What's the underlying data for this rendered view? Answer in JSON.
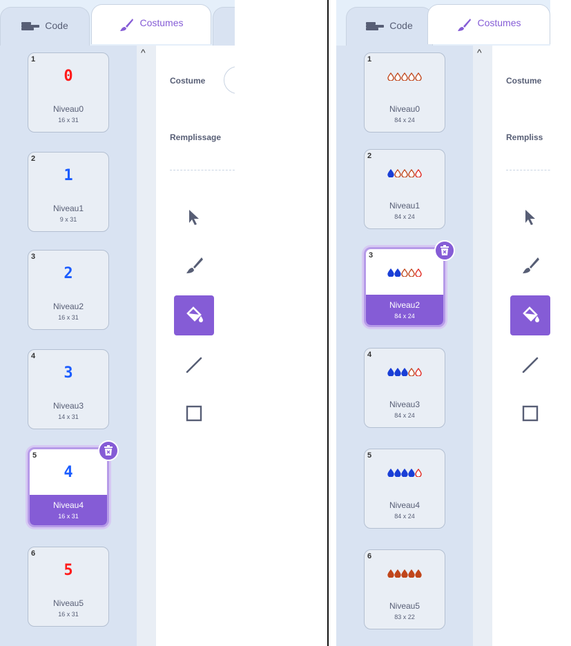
{
  "left": {
    "tabs": {
      "code": "Code",
      "costumes": "Costumes"
    },
    "fields": {
      "costume_label": "Costume",
      "fill_label": "Remplissage"
    },
    "costumes": [
      {
        "number": "1",
        "glyph": "0",
        "glyph_color": "#ff1a1a",
        "name": "Niveau0",
        "size": "16 x 31"
      },
      {
        "number": "2",
        "glyph": "1",
        "glyph_color": "#1a5cff",
        "name": "Niveau1",
        "size": "9 x 31"
      },
      {
        "number": "3",
        "glyph": "2",
        "glyph_color": "#1a5cff",
        "name": "Niveau2",
        "size": "16 x 31"
      },
      {
        "number": "4",
        "glyph": "3",
        "glyph_color": "#1a5cff",
        "name": "Niveau3",
        "size": "14 x 31"
      },
      {
        "number": "5",
        "glyph": "4",
        "glyph_color": "#1a5cff",
        "name": "Niveau4",
        "size": "16 x 31",
        "selected": true
      },
      {
        "number": "6",
        "glyph": "5",
        "glyph_color": "#ff1a1a",
        "name": "Niveau5",
        "size": "16 x 31"
      }
    ]
  },
  "right": {
    "tabs": {
      "code": "Code",
      "costumes": "Costumes"
    },
    "fields": {
      "costume_label": "Costume",
      "fill_label": "Rempliss"
    },
    "costumes": [
      {
        "number": "1",
        "name": "Niveau0",
        "size": "84 x 24",
        "drops": [
          "outline-brown",
          "outline-brown",
          "outline-brown",
          "outline-brown",
          "outline-brown"
        ]
      },
      {
        "number": "2",
        "name": "Niveau1",
        "size": "84 x 24",
        "drops": [
          "blue",
          "outline-brown",
          "outline-brown",
          "outline-brown",
          "outline-red"
        ]
      },
      {
        "number": "3",
        "name": "Niveau2",
        "size": "84 x 24",
        "selected": true,
        "drops": [
          "blue",
          "blue",
          "outline-brown",
          "outline-brown",
          "outline-red"
        ]
      },
      {
        "number": "4",
        "name": "Niveau3",
        "size": "84 x 24",
        "drops": [
          "blue",
          "blue",
          "blue",
          "outline-brown",
          "outline-red"
        ]
      },
      {
        "number": "5",
        "name": "Niveau4",
        "size": "84 x 24",
        "drops": [
          "blue",
          "blue",
          "blue",
          "blue",
          "outline-red"
        ]
      },
      {
        "number": "6",
        "name": "Niveau5",
        "size": "83 x 22",
        "drops": [
          "brown",
          "brown",
          "brown",
          "brown",
          "brown"
        ]
      }
    ]
  },
  "tools": [
    "select-tool",
    "brush-tool",
    "fill-tool",
    "line-tool",
    "rectangle-tool"
  ],
  "active_tool": "fill-tool",
  "colors": {
    "accent": "#855cd6",
    "sidebar": "#d9e3f2",
    "text": "#575e75"
  }
}
